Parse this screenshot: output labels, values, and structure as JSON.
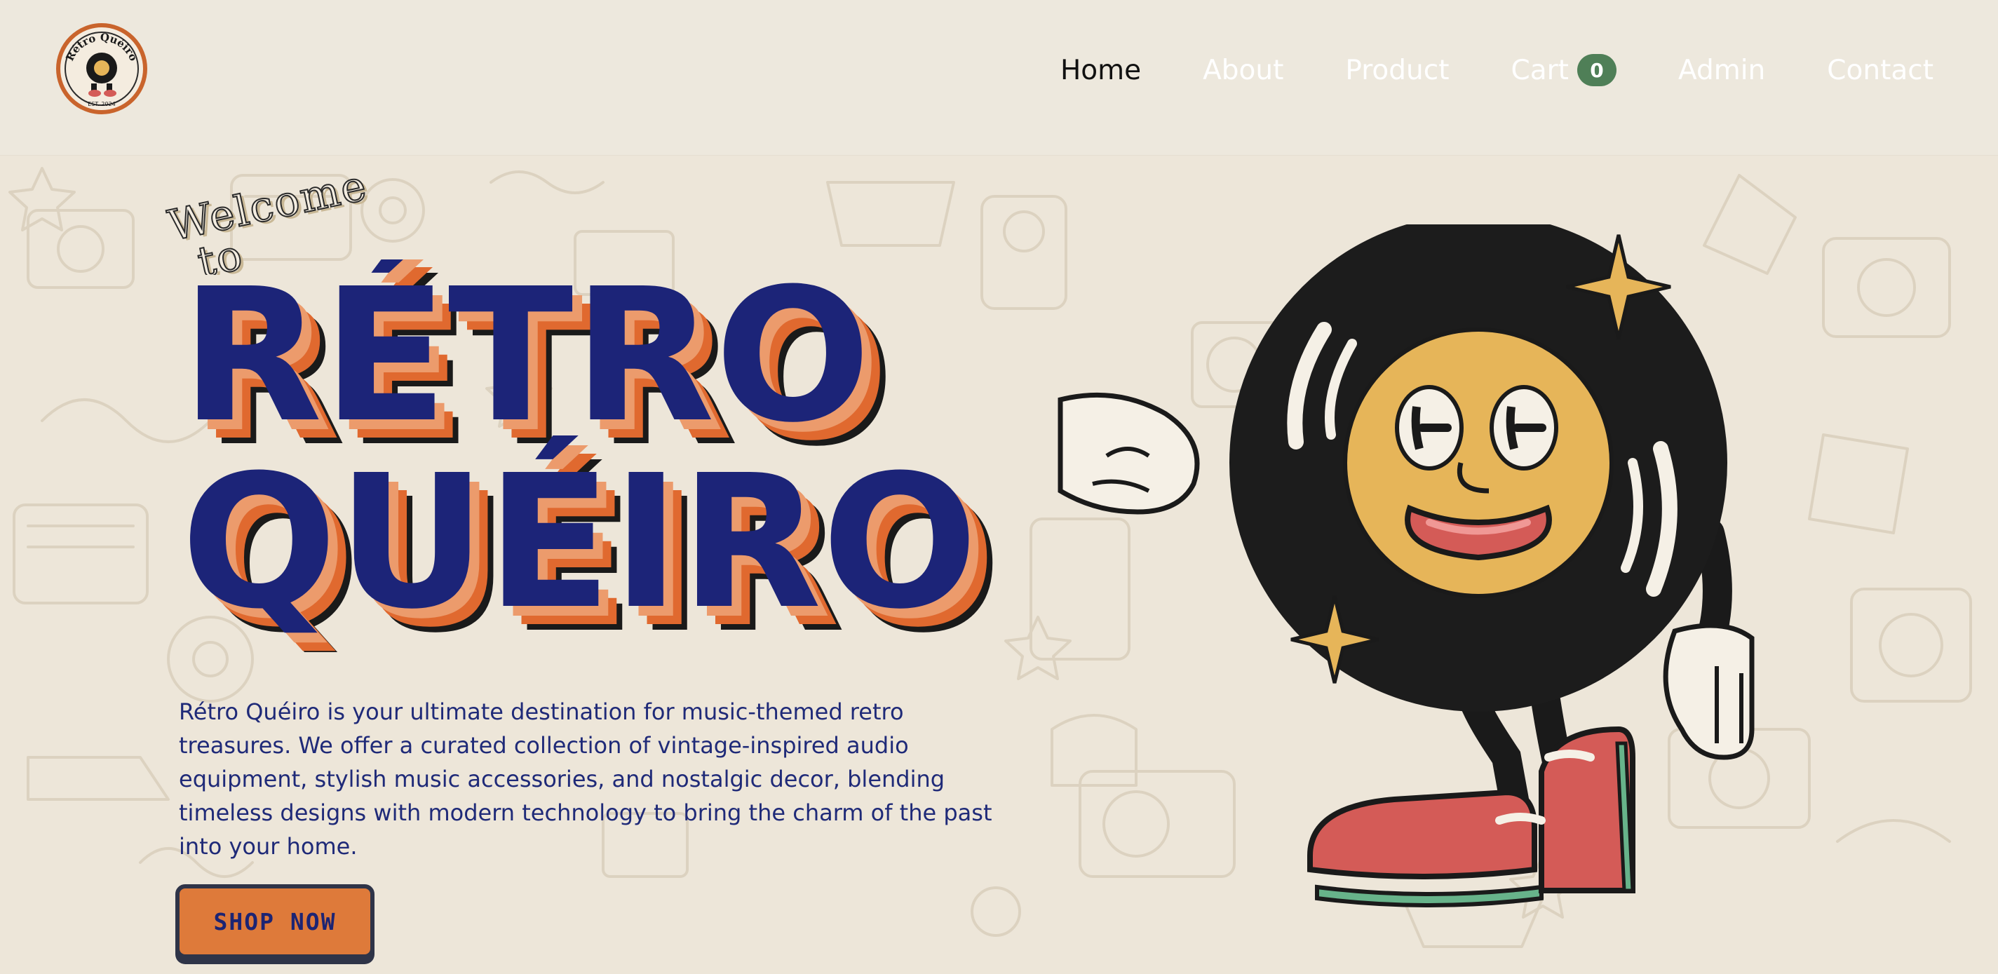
{
  "header": {
    "logo": {
      "name": "Rétro Quéiro",
      "tagline": "EST. 2024"
    },
    "nav": [
      {
        "label": "Home",
        "active": true
      },
      {
        "label": "About",
        "active": false
      },
      {
        "label": "Product",
        "active": false
      },
      {
        "label": "Cart",
        "active": false,
        "badge": "0"
      },
      {
        "label": "Admin",
        "active": false
      },
      {
        "label": "Contact",
        "active": false
      }
    ]
  },
  "hero": {
    "welcome": "Welcome",
    "welcome_to": "to",
    "title_line1": "RÉTRO",
    "title_line2": "QUÉIRO",
    "description": "Rétro Quéiro is your ultimate destination for music-themed retro treasures. We offer a curated collection of vintage-inspired audio equipment, stylish music accessories, and nostalgic decor, blending timeless designs with modern technology to bring the charm of the past into your home.",
    "cta_label": "SHOP NOW"
  },
  "colors": {
    "title_fill": "#1c2478",
    "title_shadow_light": "#ec9b6c",
    "title_shadow_dark": "#e0692f",
    "text_blue": "#1f2a78",
    "button_orange": "#de7a3a",
    "badge_green": "#4f7f57",
    "background": "#ede6d9"
  },
  "icons": {
    "logo": "vinyl-mascot-logo",
    "mascot": "vinyl-record-mascot-illustration"
  }
}
